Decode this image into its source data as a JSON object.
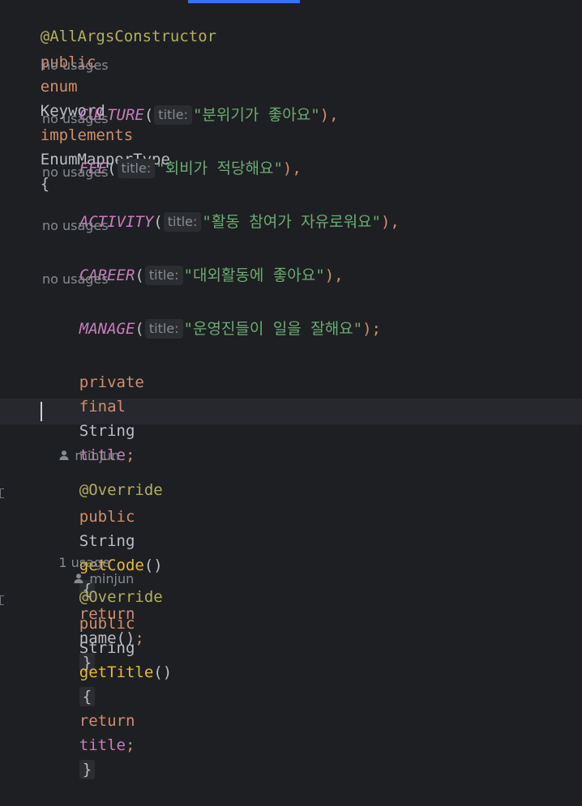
{
  "lines": {
    "annotation": "@AllArgsConstructor",
    "decl": {
      "kw_public": "public",
      "kw_enum": "enum",
      "class_name": "Keyword",
      "kw_implements": "implements",
      "iface": "EnumMapperType",
      "brace": "{"
    },
    "usage_hint": "no usages",
    "param_hint": "title:",
    "constants": [
      {
        "name": "CULTURE",
        "value": "\"분위기가 좋아요\"",
        "end": "),"
      },
      {
        "name": "FEE",
        "value": "\"회비가 적당해요\"",
        "end": "),"
      },
      {
        "name": "ACTIVITY",
        "value": "\"활동 참여가 자유로워요\"",
        "end": "),"
      },
      {
        "name": "CAREER",
        "value": "\"대외활동에 좋아요\"",
        "end": "),"
      },
      {
        "name": "MANAGE",
        "value": "\"운영진들이 일을 잘해요\"",
        "end": ");"
      }
    ],
    "field": {
      "kw_private": "private",
      "kw_final": "final",
      "type": "String",
      "name": "title",
      "semi": ";"
    },
    "author": "minjun",
    "override": "@Override",
    "method1": {
      "kw_public": "public",
      "type": "String",
      "name": "getCode",
      "parens": "()",
      "open": "{",
      "kw_return": "return",
      "expr": "name()",
      "semi": ";",
      "close": "}"
    },
    "usage_hint2": "1 usage",
    "method2": {
      "kw_public": "public",
      "type": "String",
      "name": "getTitle",
      "parens": "()",
      "open": "{",
      "kw_return": "return",
      "expr": "title",
      "semi": ";",
      "close": "}"
    }
  },
  "colors": {
    "background": "#1e1f22",
    "annotation": "#b3ae60",
    "keyword": "#cf8e6d",
    "constant": "#c77dbb",
    "string": "#6aab73",
    "method": "#e8ba36",
    "hint": "#868a91"
  },
  "icons": [
    "person-icon"
  ]
}
